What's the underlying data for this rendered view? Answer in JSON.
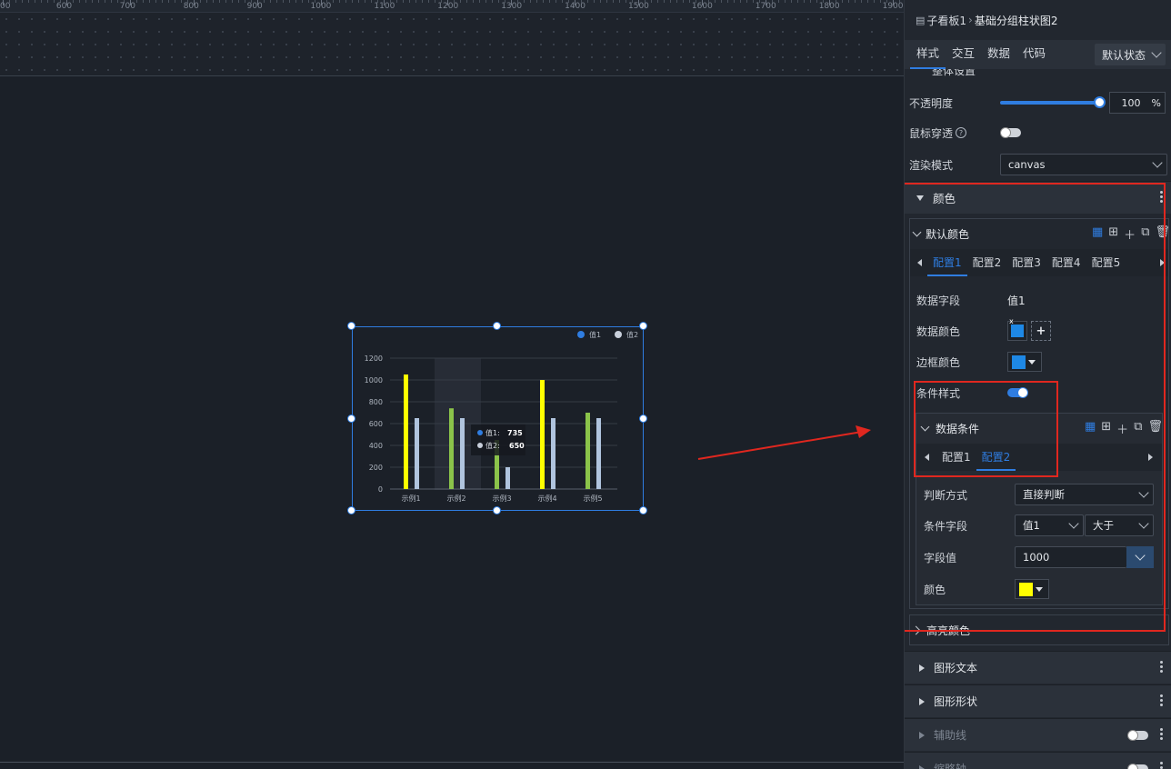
{
  "ruler": {
    "labels": [
      "00",
      "600",
      "700",
      "800",
      "900",
      "1000",
      "1100",
      "1200",
      "1300",
      "1400",
      "1500",
      "1600",
      "1700",
      "1800",
      "1900"
    ]
  },
  "chart_data": {
    "type": "bar",
    "categories": [
      "示例1",
      "示例2",
      "示例3",
      "示例4",
      "示例5"
    ],
    "series": [
      {
        "name": "值1",
        "values": [
          1050,
          740,
          450,
          1000,
          700
        ],
        "colors": [
          "#ffff00",
          "#8bc34a",
          "#8bc34a",
          "#ffff00",
          "#8bc34a"
        ]
      },
      {
        "name": "值2",
        "values": [
          650,
          650,
          200,
          650,
          650
        ],
        "color": "#b0c4de"
      }
    ],
    "ylim": [
      0,
      1200
    ],
    "yticks": [
      "0",
      "200",
      "400",
      "600",
      "800",
      "1000",
      "1200"
    ],
    "legend": {
      "position": "top-right",
      "items": [
        "值1",
        "值2"
      ],
      "colors": [
        "#2f7de1",
        "#c8cfdb"
      ]
    },
    "tooltip": {
      "rows": [
        {
          "label": "值1:",
          "value": "735"
        },
        {
          "label": "值2:",
          "value": "650"
        }
      ]
    }
  },
  "panel": {
    "breadcrumb": {
      "parent": "子看板1",
      "current": "基础分组柱状图2"
    },
    "tabs": [
      "样式",
      "交互",
      "数据",
      "代码"
    ],
    "state_select": "默认状态",
    "partial_header": "整体设置",
    "opacity": {
      "label": "不透明度",
      "value": "100",
      "unit": "%",
      "level": 1.0
    },
    "mouse_through": {
      "label": "鼠标穿透",
      "help": "?"
    },
    "render_mode": {
      "label": "渲染模式",
      "value": "canvas"
    },
    "color_section": {
      "title": "颜色"
    },
    "default_color": {
      "title": "默认颜色",
      "configs": [
        "配置1",
        "配置2",
        "配置3",
        "配置4",
        "配置5"
      ],
      "data_field": {
        "label": "数据字段",
        "value": "值1"
      },
      "data_color": {
        "label": "数据颜色",
        "color": "#1e88e5",
        "close": "x",
        "add": "+"
      },
      "border_color": {
        "label": "边框颜色",
        "color": "#1e88e5"
      },
      "cond_style": {
        "label": "条件样式"
      },
      "data_condition": {
        "title": "数据条件",
        "configs": [
          "配置1",
          "配置2"
        ],
        "judge": {
          "label": "判断方式",
          "value": "直接判断"
        },
        "field": {
          "label": "条件字段",
          "value": "值1",
          "op": "大于"
        },
        "field_value": {
          "label": "字段值",
          "value": "1000"
        },
        "color": {
          "label": "颜色",
          "color": "#ffff00"
        }
      }
    },
    "highlight": {
      "title": "高亮颜色"
    },
    "sections": [
      {
        "title": "图形文本"
      },
      {
        "title": "图形形状"
      },
      {
        "title": "辅助线"
      },
      {
        "title": "缩略轴"
      }
    ],
    "accent": "#2f7de1",
    "annotation_color": "#e0271f"
  }
}
